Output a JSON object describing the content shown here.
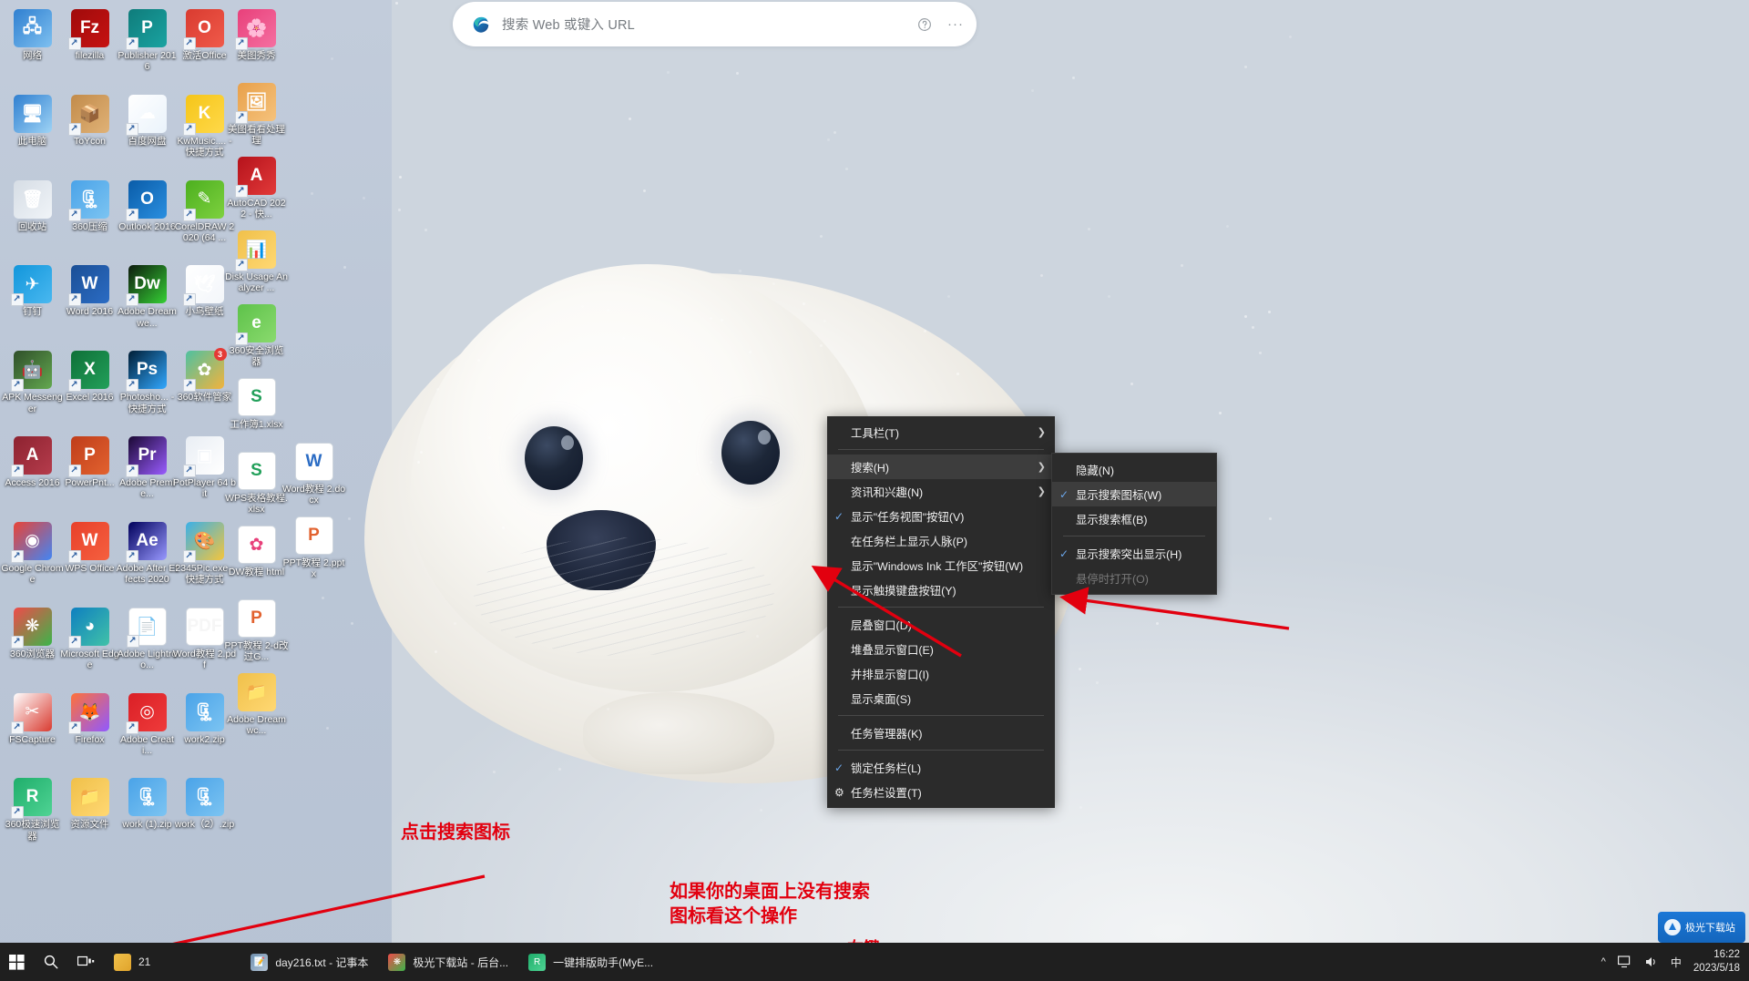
{
  "window": {
    "os": "Windows 10 Desktop"
  },
  "edge_search": {
    "icon": "edge-icon",
    "placeholder": "搜索 Web 或键入 URL",
    "help_icon": "?",
    "more_icon": "···"
  },
  "desktop_icons": [
    {
      "label": "网络",
      "type": "network",
      "color1": "#2f7fd0",
      "color2": "#7ec0f0",
      "glyph": "🖧",
      "shortcut": false
    },
    {
      "label": "filezilla",
      "type": "app",
      "color1": "#a00b0b",
      "color2": "#c61212",
      "glyph": "Fz",
      "shortcut": true
    },
    {
      "label": "Publisher 2016",
      "type": "office",
      "color1": "#0f7c7b",
      "color2": "#1aa3a1",
      "glyph": "P",
      "shortcut": true
    },
    {
      "label": "激活Office",
      "type": "app",
      "color1": "#d93b30",
      "color2": "#f05a4a",
      "glyph": "O",
      "shortcut": true
    },
    {
      "label": "此电脑",
      "type": "computer",
      "color1": "#2f7fd0",
      "color2": "#9ed3f5",
      "glyph": "🖥",
      "shortcut": false
    },
    {
      "label": "ToYcon",
      "type": "app",
      "color1": "#c28b4a",
      "color2": "#e0b277",
      "glyph": "📦",
      "shortcut": true
    },
    {
      "label": "百度网盘",
      "type": "app",
      "color1": "#ffffff",
      "color2": "#eaf3fb",
      "glyph": "☁",
      "shortcut": true
    },
    {
      "label": "KwMusic.... - 快捷方式",
      "type": "app",
      "color1": "#f5c518",
      "color2": "#ffd94a",
      "glyph": "K",
      "shortcut": true
    },
    {
      "label": "回收站",
      "type": "bin",
      "color1": "#d6dde5",
      "color2": "#f0f4f8",
      "glyph": "🗑",
      "shortcut": false
    },
    {
      "label": "360压缩",
      "type": "app",
      "color1": "#4aa3e8",
      "color2": "#7cc4f2",
      "glyph": "🗜",
      "shortcut": true
    },
    {
      "label": "Outlook 2016",
      "type": "office",
      "color1": "#0a5ca8",
      "color2": "#2a8fe0",
      "glyph": "O",
      "shortcut": true
    },
    {
      "label": "CorelDRAW 2020 (64 ...",
      "type": "app",
      "color1": "#4caf1f",
      "color2": "#7ed13f",
      "glyph": "✎",
      "shortcut": true
    },
    {
      "label": "钉钉",
      "type": "app",
      "color1": "#1296db",
      "color2": "#49b8f0",
      "glyph": "✈",
      "shortcut": true
    },
    {
      "label": "Word 2016",
      "type": "office",
      "color1": "#1b4f96",
      "color2": "#2b6cc4",
      "glyph": "W",
      "shortcut": true
    },
    {
      "label": "Adobe Dreamwe...",
      "type": "adobe",
      "color1": "#0d1a0d",
      "color2": "#35d035",
      "glyph": "Dw",
      "shortcut": true
    },
    {
      "label": "小鸟壁纸",
      "type": "app",
      "color1": "#ffffff",
      "color2": "#f3f6fa",
      "glyph": "🕊",
      "shortcut": true
    },
    {
      "label": "APK Messenger",
      "type": "app",
      "color1": "#2f4f2a",
      "color2": "#63a84f",
      "glyph": "🤖",
      "shortcut": true
    },
    {
      "label": "Excel 2016",
      "type": "office",
      "color1": "#0f7038",
      "color2": "#22a05a",
      "glyph": "X",
      "shortcut": true
    },
    {
      "label": "Photosho... - 快捷方式",
      "type": "adobe",
      "color1": "#001e36",
      "color2": "#31a8ff",
      "glyph": "Ps",
      "shortcut": true
    },
    {
      "label": "360软件管家",
      "type": "app",
      "color1": "#4fc1a0",
      "color2": "#f2b33d",
      "glyph": "✿",
      "shortcut": true,
      "badge": "3"
    },
    {
      "label": "Access 2016",
      "type": "office",
      "color1": "#8d2230",
      "color2": "#b53c4c",
      "glyph": "A",
      "shortcut": true
    },
    {
      "label": "PowerPnt...",
      "type": "office",
      "color1": "#bf3d1a",
      "color2": "#e2622f",
      "glyph": "P",
      "shortcut": true
    },
    {
      "label": "Adobe Premie...",
      "type": "adobe",
      "color1": "#1a0833",
      "color2": "#9a5cff",
      "glyph": "Pr",
      "shortcut": true
    },
    {
      "label": "PotPlayer 64 bit",
      "type": "app",
      "color1": "#e9eef4",
      "color2": "#ffffff",
      "glyph": "▣",
      "shortcut": true
    },
    {
      "label": "Google Chrome",
      "type": "app",
      "color1": "#ea4335",
      "color2": "#4285f4",
      "glyph": "◉",
      "shortcut": true
    },
    {
      "label": "WPS Office",
      "type": "app",
      "color1": "#e8402a",
      "color2": "#f5603f",
      "glyph": "W",
      "shortcut": true
    },
    {
      "label": "Adobe After Effects 2020",
      "type": "adobe",
      "color1": "#00005b",
      "color2": "#9999ff",
      "glyph": "Ae",
      "shortcut": true
    },
    {
      "label": "2345Pic.exe - 快捷方式",
      "type": "app",
      "color1": "#3ab0e8",
      "color2": "#f3c53d",
      "glyph": "🎨",
      "shortcut": true
    },
    {
      "label": "360浏览器",
      "type": "app",
      "color1": "#f04a4a",
      "color2": "#3bb54a",
      "glyph": "❋",
      "shortcut": true
    },
    {
      "label": "Microsoft Edge",
      "type": "app",
      "color1": "#0e7fc0",
      "color2": "#41c2a8",
      "glyph": "◕",
      "shortcut": true
    },
    {
      "label": "Adobe Lightroo...",
      "type": "file",
      "color1": "#f3f3f3",
      "color2": "#ffffff",
      "glyph": "📄",
      "shortcut": true
    },
    {
      "label": "Word教程 2.pdf",
      "type": "pdf",
      "color1": "#ffffff",
      "color2": "#f6f6f6",
      "glyph": "PDF",
      "shortcut": false
    },
    {
      "label": "FSCapture",
      "type": "app",
      "color1": "#ffffff",
      "color2": "#d93b30",
      "glyph": "✂",
      "shortcut": true
    },
    {
      "label": "Firefox",
      "type": "app",
      "color1": "#ff7139",
      "color2": "#9059ff",
      "glyph": "🦊",
      "shortcut": true
    },
    {
      "label": "Adobe Creati...",
      "type": "adobe",
      "color1": "#da1f26",
      "color2": "#ef3b3b",
      "glyph": "◎",
      "shortcut": true
    },
    {
      "label": "work2.zip",
      "type": "zip",
      "color1": "#4aa3e8",
      "color2": "#7cc4f2",
      "glyph": "🗜",
      "shortcut": false
    },
    {
      "label": "360极速浏览器",
      "type": "app",
      "color1": "#1fae6b",
      "color2": "#4fd394",
      "glyph": "R",
      "shortcut": true
    },
    {
      "label": "资源文件",
      "type": "folder",
      "color1": "#f0c04a",
      "color2": "#ffd873",
      "glyph": "📁",
      "shortcut": false
    },
    {
      "label": "work (1).zip",
      "type": "zip",
      "color1": "#4aa3e8",
      "color2": "#7cc4f2",
      "glyph": "🗜",
      "shortcut": false
    },
    {
      "label": "work（2）.zip",
      "type": "zip",
      "color1": "#4aa3e8",
      "color2": "#7cc4f2",
      "glyph": "🗜",
      "shortcut": false
    }
  ],
  "desktop_icons_col5": [
    {
      "label": "美图秀秀",
      "type": "app",
      "color1": "#e8407a",
      "color2": "#f56fa1",
      "glyph": "🌸",
      "shortcut": true
    },
    {
      "label": "美图看看处理 理",
      "type": "app",
      "color1": "#e8a04a",
      "color2": "#f5c27c",
      "glyph": "🖼",
      "shortcut": true
    },
    {
      "label": "AutoCAD 2022 - 快...",
      "type": "app",
      "color1": "#b5121b",
      "color2": "#e23a3a",
      "glyph": "A",
      "shortcut": true
    },
    {
      "label": "Disk Usage Analyzer ...",
      "type": "app",
      "color1": "#f0c04a",
      "color2": "#ffd873",
      "glyph": "📊",
      "shortcut": true
    },
    {
      "label": "360安全浏览器",
      "type": "app",
      "color1": "#5ec24a",
      "color2": "#8ada6e",
      "glyph": "e",
      "shortcut": true
    },
    {
      "label": "工作簿1.xlsx",
      "type": "file",
      "color1": "#ffffff",
      "color2": "#22a05a",
      "glyph": "S",
      "shortcut": false
    },
    {
      "label": "WPS表格教程.xlsx",
      "type": "file",
      "color1": "#ffffff",
      "color2": "#22a05a",
      "glyph": "S",
      "shortcut": false
    },
    {
      "label": "DW教程 html",
      "type": "file",
      "color1": "#ffffff",
      "color2": "#e8407a",
      "glyph": "✿",
      "shortcut": false
    },
    {
      "label": "PPT教程 2-d改过G...",
      "type": "file",
      "color1": "#ffffff",
      "color2": "#e2622f",
      "glyph": "P",
      "shortcut": false
    },
    {
      "label": "Adobe Dreamwc...",
      "type": "folder",
      "color1": "#f0c04a",
      "color2": "#ffd873",
      "glyph": "📁",
      "shortcut": false
    }
  ],
  "desktop_icons_col6": [
    {
      "label": "Word教程 2.docx",
      "type": "file",
      "color1": "#ffffff",
      "color2": "#2b6cc4",
      "glyph": "W",
      "shortcut": false
    },
    {
      "label": "PPT教程 2.pptx",
      "type": "file",
      "color1": "#ffffff",
      "color2": "#e2622f",
      "glyph": "P",
      "shortcut": false
    }
  ],
  "context_menu": {
    "items": [
      {
        "label": "工具栏(T)",
        "checked": false,
        "arrow": true,
        "highlight": false,
        "disabled": false,
        "sep_after": true,
        "icon": ""
      },
      {
        "label": "搜索(H)",
        "checked": false,
        "arrow": true,
        "highlight": true,
        "disabled": false,
        "sep_after": false,
        "icon": ""
      },
      {
        "label": "资讯和兴趣(N)",
        "checked": false,
        "arrow": true,
        "highlight": false,
        "disabled": false,
        "sep_after": false,
        "icon": ""
      },
      {
        "label": "显示\"任务视图\"按钮(V)",
        "checked": true,
        "arrow": false,
        "highlight": false,
        "disabled": false,
        "sep_after": false,
        "icon": ""
      },
      {
        "label": "在任务栏上显示人脉(P)",
        "checked": false,
        "arrow": false,
        "highlight": false,
        "disabled": false,
        "sep_after": false,
        "icon": ""
      },
      {
        "label": "显示\"Windows Ink 工作区\"按钮(W)",
        "checked": false,
        "arrow": false,
        "highlight": false,
        "disabled": false,
        "sep_after": false,
        "icon": ""
      },
      {
        "label": "显示触摸键盘按钮(Y)",
        "checked": false,
        "arrow": false,
        "highlight": false,
        "disabled": false,
        "sep_after": true,
        "icon": ""
      },
      {
        "label": "层叠窗口(D)",
        "checked": false,
        "arrow": false,
        "highlight": false,
        "disabled": false,
        "sep_after": false,
        "icon": ""
      },
      {
        "label": "堆叠显示窗口(E)",
        "checked": false,
        "arrow": false,
        "highlight": false,
        "disabled": false,
        "sep_after": false,
        "icon": ""
      },
      {
        "label": "并排显示窗口(I)",
        "checked": false,
        "arrow": false,
        "highlight": false,
        "disabled": false,
        "sep_after": false,
        "icon": ""
      },
      {
        "label": "显示桌面(S)",
        "checked": false,
        "arrow": false,
        "highlight": false,
        "disabled": false,
        "sep_after": true,
        "icon": ""
      },
      {
        "label": "任务管理器(K)",
        "checked": false,
        "arrow": false,
        "highlight": false,
        "disabled": false,
        "sep_after": true,
        "icon": ""
      },
      {
        "label": "锁定任务栏(L)",
        "checked": true,
        "arrow": false,
        "highlight": false,
        "disabled": false,
        "sep_after": false,
        "icon": ""
      },
      {
        "label": "任务栏设置(T)",
        "checked": false,
        "arrow": false,
        "highlight": false,
        "disabled": false,
        "sep_after": false,
        "icon": "gear-icon"
      }
    ]
  },
  "context_submenu": {
    "items": [
      {
        "label": "隐藏(N)",
        "checked": false,
        "highlight": false,
        "disabled": false,
        "sep_after": false
      },
      {
        "label": "显示搜索图标(W)",
        "checked": true,
        "highlight": true,
        "disabled": false,
        "sep_after": false
      },
      {
        "label": "显示搜索框(B)",
        "checked": false,
        "highlight": false,
        "disabled": false,
        "sep_after": true
      },
      {
        "label": "显示搜索突出显示(H)",
        "checked": true,
        "highlight": false,
        "disabled": false,
        "sep_after": false
      },
      {
        "label": "悬停时打开(O)",
        "checked": false,
        "highlight": false,
        "disabled": true,
        "sep_after": false
      }
    ]
  },
  "annotations": {
    "click_search_icon": "点击搜索图标",
    "no_search_icon": "如果你的桌面上没有搜索\n图标看这个操作",
    "right_click": "右键",
    "color": "#e2000f"
  },
  "taskbar": {
    "start_icon": "windows-icon",
    "search_icon": "search-icon",
    "taskview_icon": "task-view-icon",
    "explorer_label": "21",
    "tasks": [
      {
        "label": "day216.txt - 记事本",
        "icon_color1": "#6f8fae",
        "icon_color2": "#b7c8d8",
        "glyph": "📝"
      },
      {
        "label": "极光下载站 - 后台...",
        "icon_color1": "#f04a4a",
        "icon_color2": "#3bb54a",
        "glyph": "❋"
      },
      {
        "label": "一键排版助手(MyE...",
        "icon_color1": "#1fae6b",
        "icon_color2": "#4fd394",
        "glyph": "R"
      }
    ],
    "tray": {
      "chevron": "^",
      "monitor_icon": "monitor-icon",
      "volume_icon": "volume-icon",
      "ime_label": "中",
      "time": "16:22",
      "date": "2023/5/18"
    },
    "watermark": "极光下载站"
  }
}
